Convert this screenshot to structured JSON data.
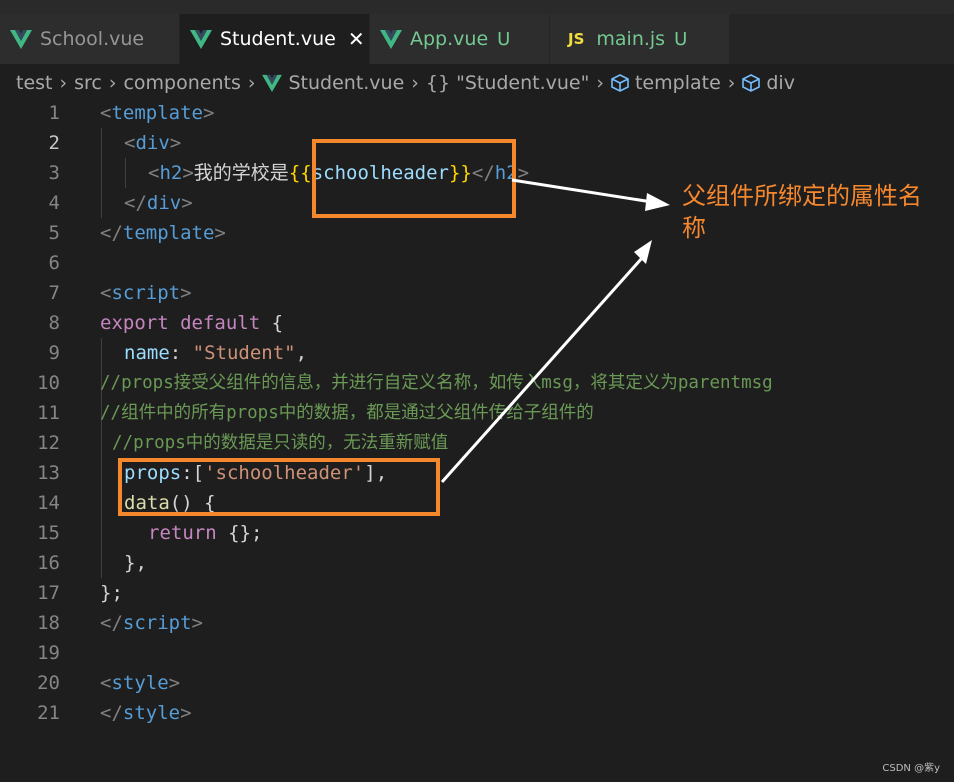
{
  "tabs": [
    {
      "name": "School.vue",
      "status": ""
    },
    {
      "name": "Student.vue",
      "status": "",
      "close": "✕"
    },
    {
      "name": "App.vue",
      "status": "U"
    },
    {
      "name": "main.js",
      "status": "U",
      "icon_text": "JS"
    }
  ],
  "breadcrumb": {
    "items": [
      "test",
      "src",
      "components",
      "Student.vue",
      "\"Student.vue\"",
      "template",
      "div"
    ],
    "obj_glyph": "{}"
  },
  "lines": [
    {
      "num": "1",
      "seg": [
        "<",
        "template",
        ">"
      ]
    },
    {
      "num": "2",
      "seg": [
        "<",
        "div",
        ">"
      ]
    },
    {
      "num": "3",
      "seg": [
        "<",
        "h2",
        ">",
        "我的学校是",
        "{{",
        "schoolheader",
        "}}",
        "</",
        "h2",
        ">"
      ]
    },
    {
      "num": "4",
      "seg": [
        "</",
        "div",
        ">"
      ]
    },
    {
      "num": "5",
      "seg": [
        "</",
        "template",
        ">"
      ]
    },
    {
      "num": "6",
      "seg": []
    },
    {
      "num": "7",
      "seg": [
        "<",
        "script",
        ">"
      ]
    },
    {
      "num": "8",
      "seg": [
        "export",
        " ",
        "default",
        " {"
      ]
    },
    {
      "num": "9",
      "seg": [
        "name",
        ": ",
        "\"Student\"",
        ","
      ]
    },
    {
      "num": "10",
      "seg": [
        "//props接受父组件的信息，并进行自定义名称，如传入msg，将其定义为parentmsg"
      ]
    },
    {
      "num": "11",
      "seg": [
        "//组件中的所有props中的数据，都是通过父组件传给子组件的"
      ]
    },
    {
      "num": "12",
      "seg": [
        "//props中的数据是只读的，无法重新赋值"
      ]
    },
    {
      "num": "13",
      "seg": [
        "props",
        ":[",
        "'schoolheader'",
        "],"
      ]
    },
    {
      "num": "14",
      "seg": [
        "data",
        "() {"
      ]
    },
    {
      "num": "15",
      "seg": [
        "return",
        " {};"
      ]
    },
    {
      "num": "16",
      "seg": [
        "},"
      ]
    },
    {
      "num": "17",
      "seg": [
        "};"
      ]
    },
    {
      "num": "18",
      "seg": [
        "</",
        "script",
        ">"
      ]
    },
    {
      "num": "19",
      "seg": []
    },
    {
      "num": "20",
      "seg": [
        "<",
        "style",
        ">"
      ]
    },
    {
      "num": "21",
      "seg": [
        "</",
        "style",
        ">"
      ]
    }
  ],
  "annotation": {
    "text": "父组件所绑定的属性名称"
  },
  "watermark": "CSDN @紫y",
  "colors": {
    "highlight": "#f5872d",
    "vue": "#41b883",
    "js": "#f1dd3f",
    "untracked": "#73c991"
  }
}
